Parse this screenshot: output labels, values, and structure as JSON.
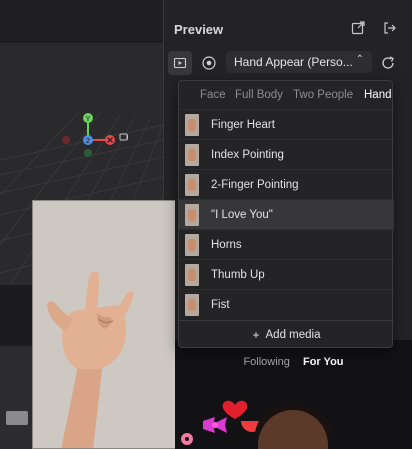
{
  "preview": {
    "title": "Preview",
    "mode_dropdown": "Hand Appear (Perso..."
  },
  "menu": {
    "tabs": [
      "Face",
      "Full Body",
      "Two People",
      "Hand"
    ],
    "active_tab": "Hand",
    "items": [
      {
        "label": "Finger Heart"
      },
      {
        "label": "Index Pointing"
      },
      {
        "label": "2-Finger Pointing"
      },
      {
        "label": "\"I Love You\"",
        "selected": true
      },
      {
        "label": "Horns"
      },
      {
        "label": "Thumb Up"
      },
      {
        "label": "Fist"
      }
    ],
    "add_media": "Add media"
  },
  "phone": {
    "tab_following": "Following",
    "tab_for_you": "For You"
  },
  "gizmo": {
    "y_label": "Y",
    "z_label": "2"
  }
}
